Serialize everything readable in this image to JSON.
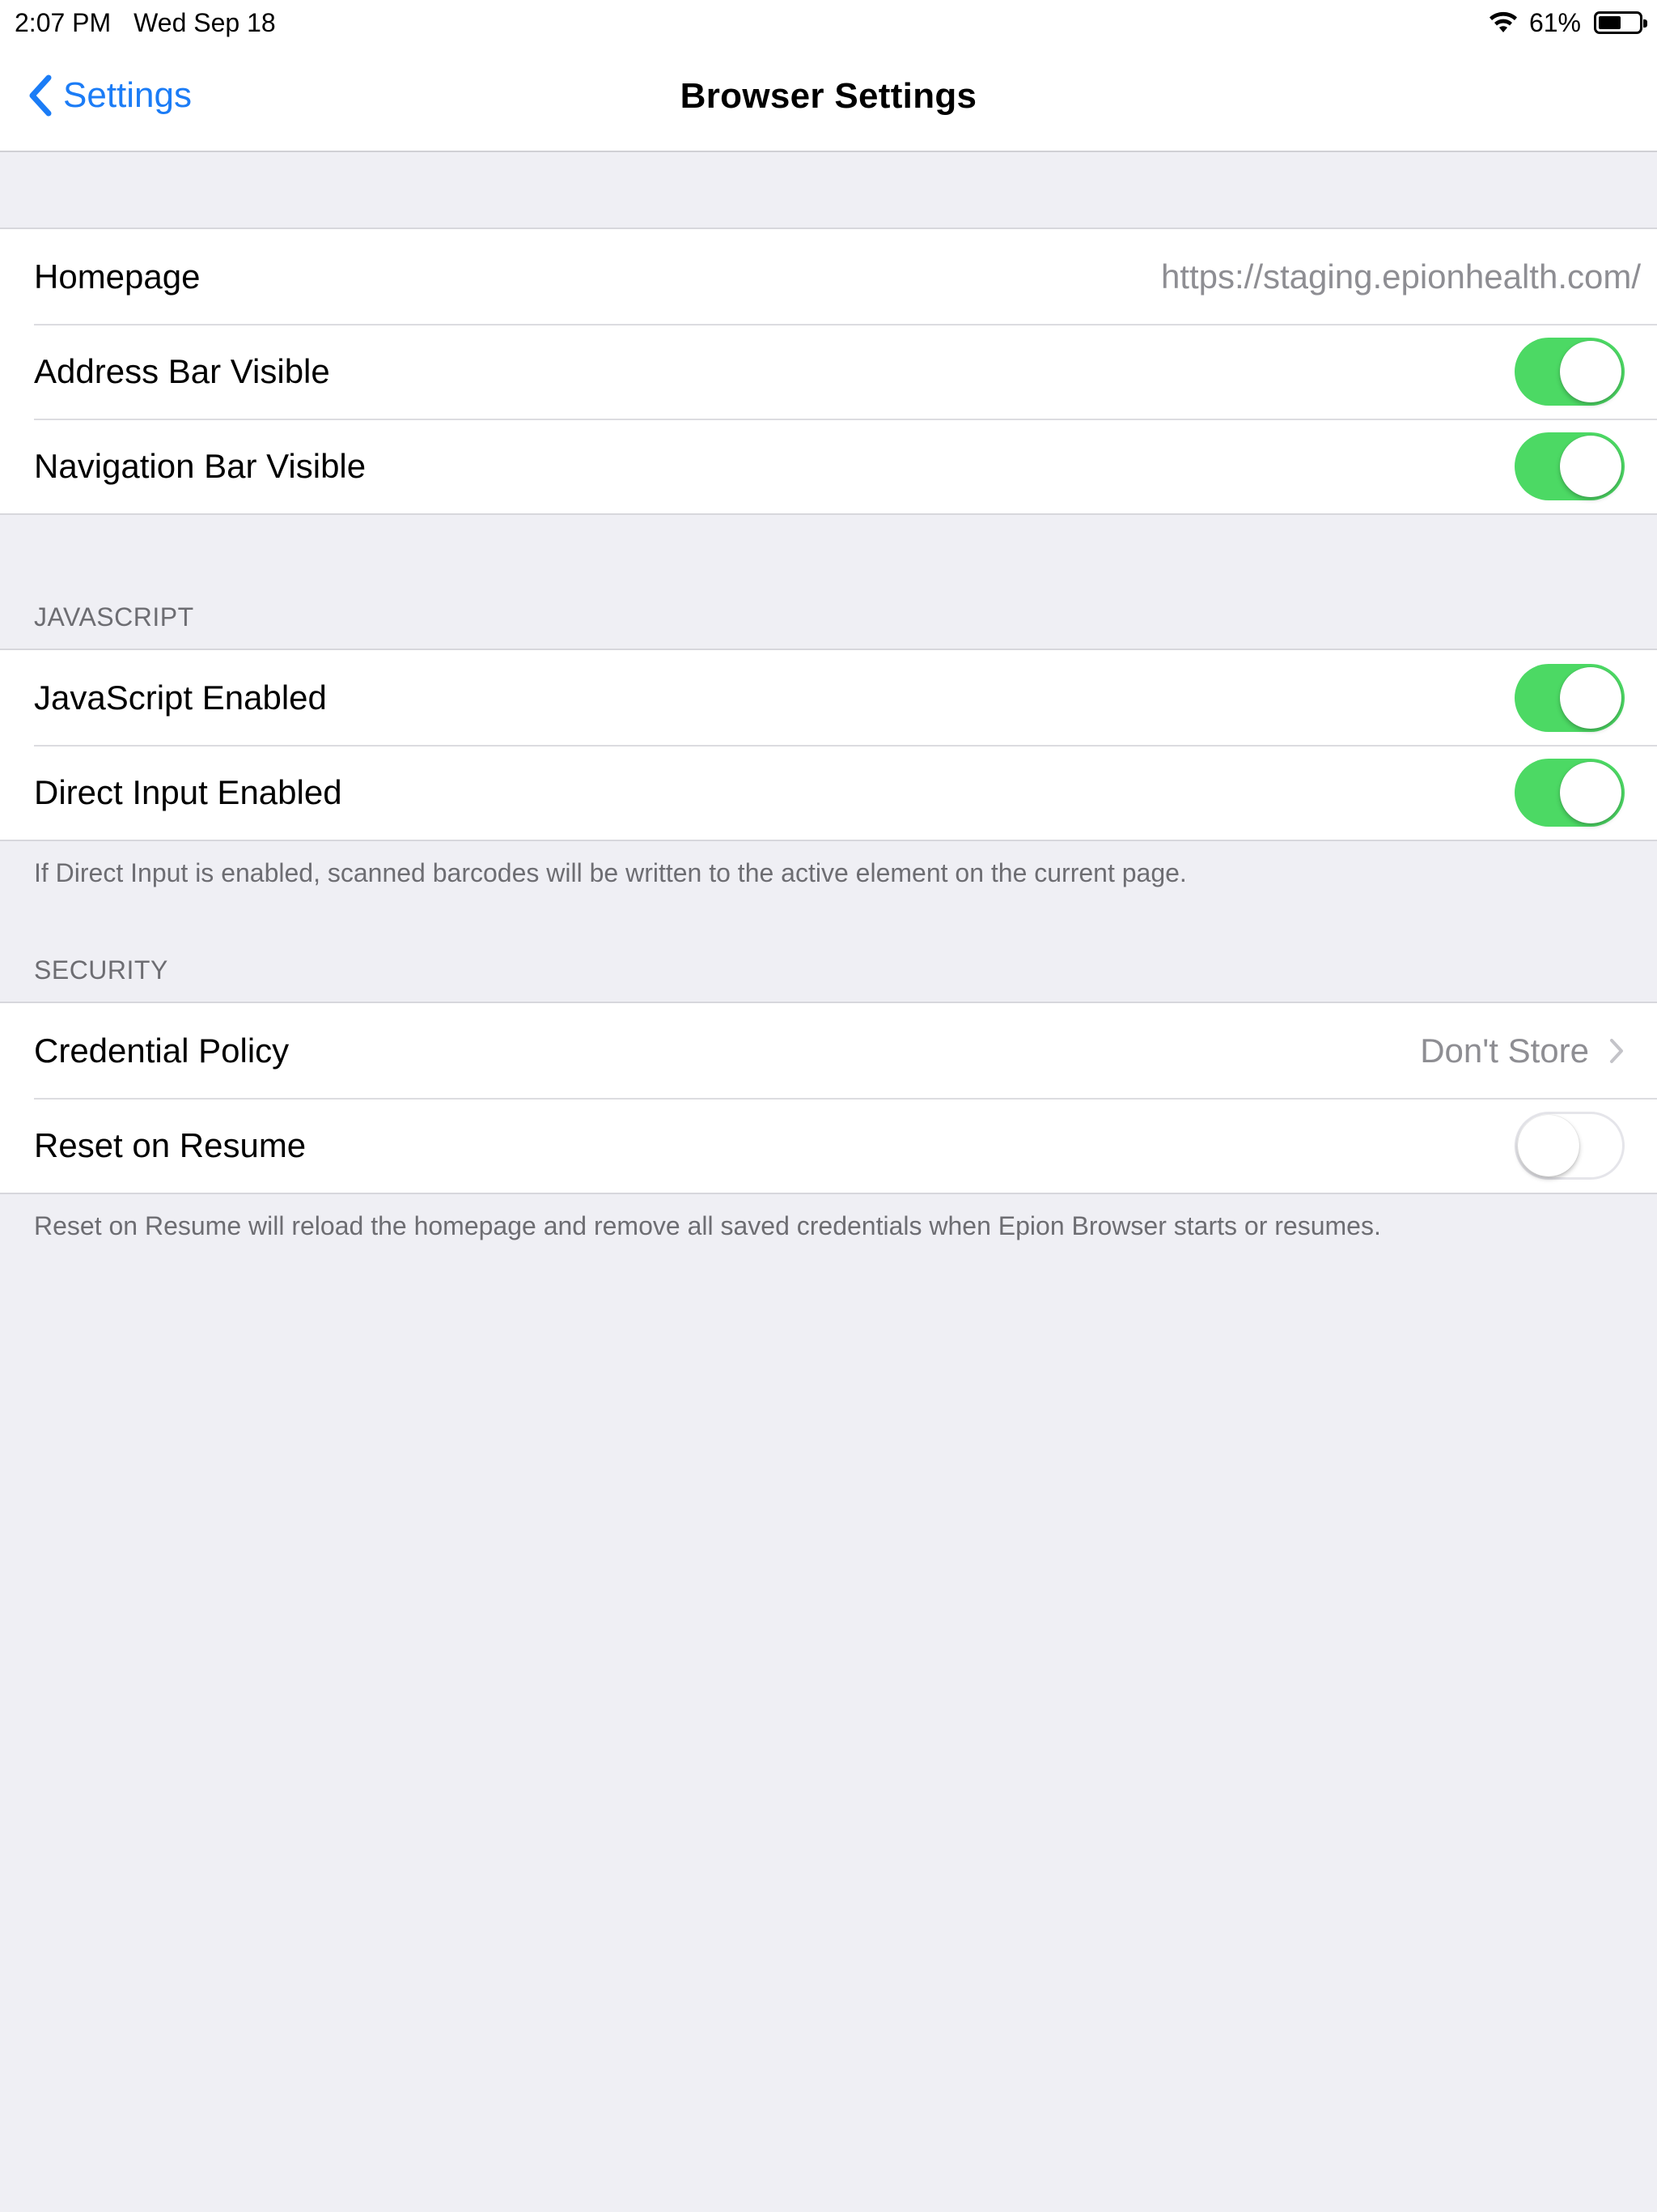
{
  "status_bar": {
    "time": "2:07 PM",
    "date": "Wed Sep 18",
    "battery_percent_label": "61%",
    "battery_level": 0.61,
    "icons": [
      "wifi-icon",
      "battery-icon"
    ]
  },
  "nav": {
    "back_label": "Settings",
    "title": "Browser Settings",
    "back_icon": "chevron-left-icon"
  },
  "general": {
    "homepage_label": "Homepage",
    "homepage_value": "https://staging.epionhealth.com/",
    "address_bar_label": "Address Bar Visible",
    "address_bar_on": true,
    "navigation_bar_label": "Navigation Bar Visible",
    "navigation_bar_on": true
  },
  "javascript": {
    "header": "JAVASCRIPT",
    "js_enabled_label": "JavaScript Enabled",
    "js_enabled_on": true,
    "direct_input_label": "Direct Input Enabled",
    "direct_input_on": true,
    "footer": "If Direct Input is enabled, scanned barcodes will be written to the active element on the current page."
  },
  "security": {
    "header": "SECURITY",
    "credential_policy_label": "Credential Policy",
    "credential_policy_value": "Don't Store",
    "reset_on_resume_label": "Reset on Resume",
    "reset_on_resume_on": false,
    "footer": "Reset on Resume will reload the homepage and remove all saved credentials when Epion Browser starts or resumes."
  },
  "colors": {
    "accent": "#1b7cf6",
    "toggle_on": "#4cd964",
    "background": "#efeff4",
    "secondary_text": "#8e8e93"
  }
}
